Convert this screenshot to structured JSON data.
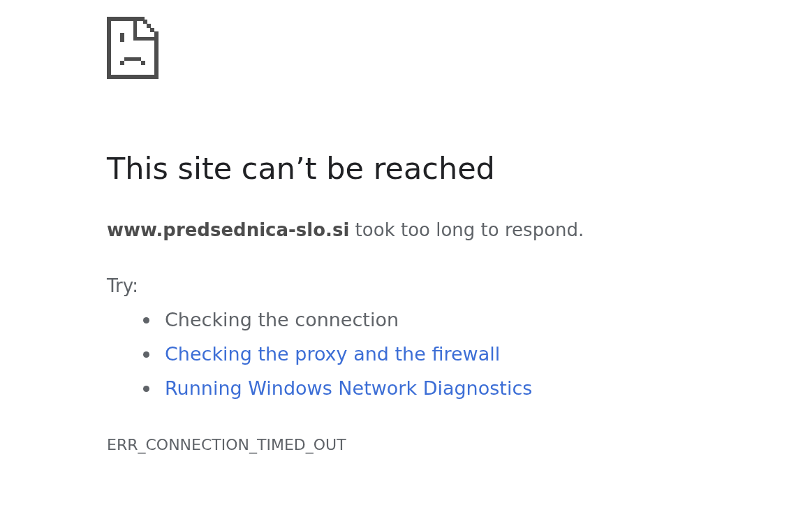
{
  "page": {
    "heading": "This site can’t be reached",
    "message": "**www.predsednica-slo.si** took too long to respond.",
    "try_label": "Try:",
    "suggestions": [
      {
        "text": "Checking the connection",
        "kind": "text"
      },
      {
        "text": "Checking the proxy and the firewall",
        "kind": "link"
      },
      {
        "text": "Running Windows Network Diagnostics",
        "kind": "link"
      }
    ],
    "error_code": "ERR_CONNECTION_TIMED_OUT"
  }
}
